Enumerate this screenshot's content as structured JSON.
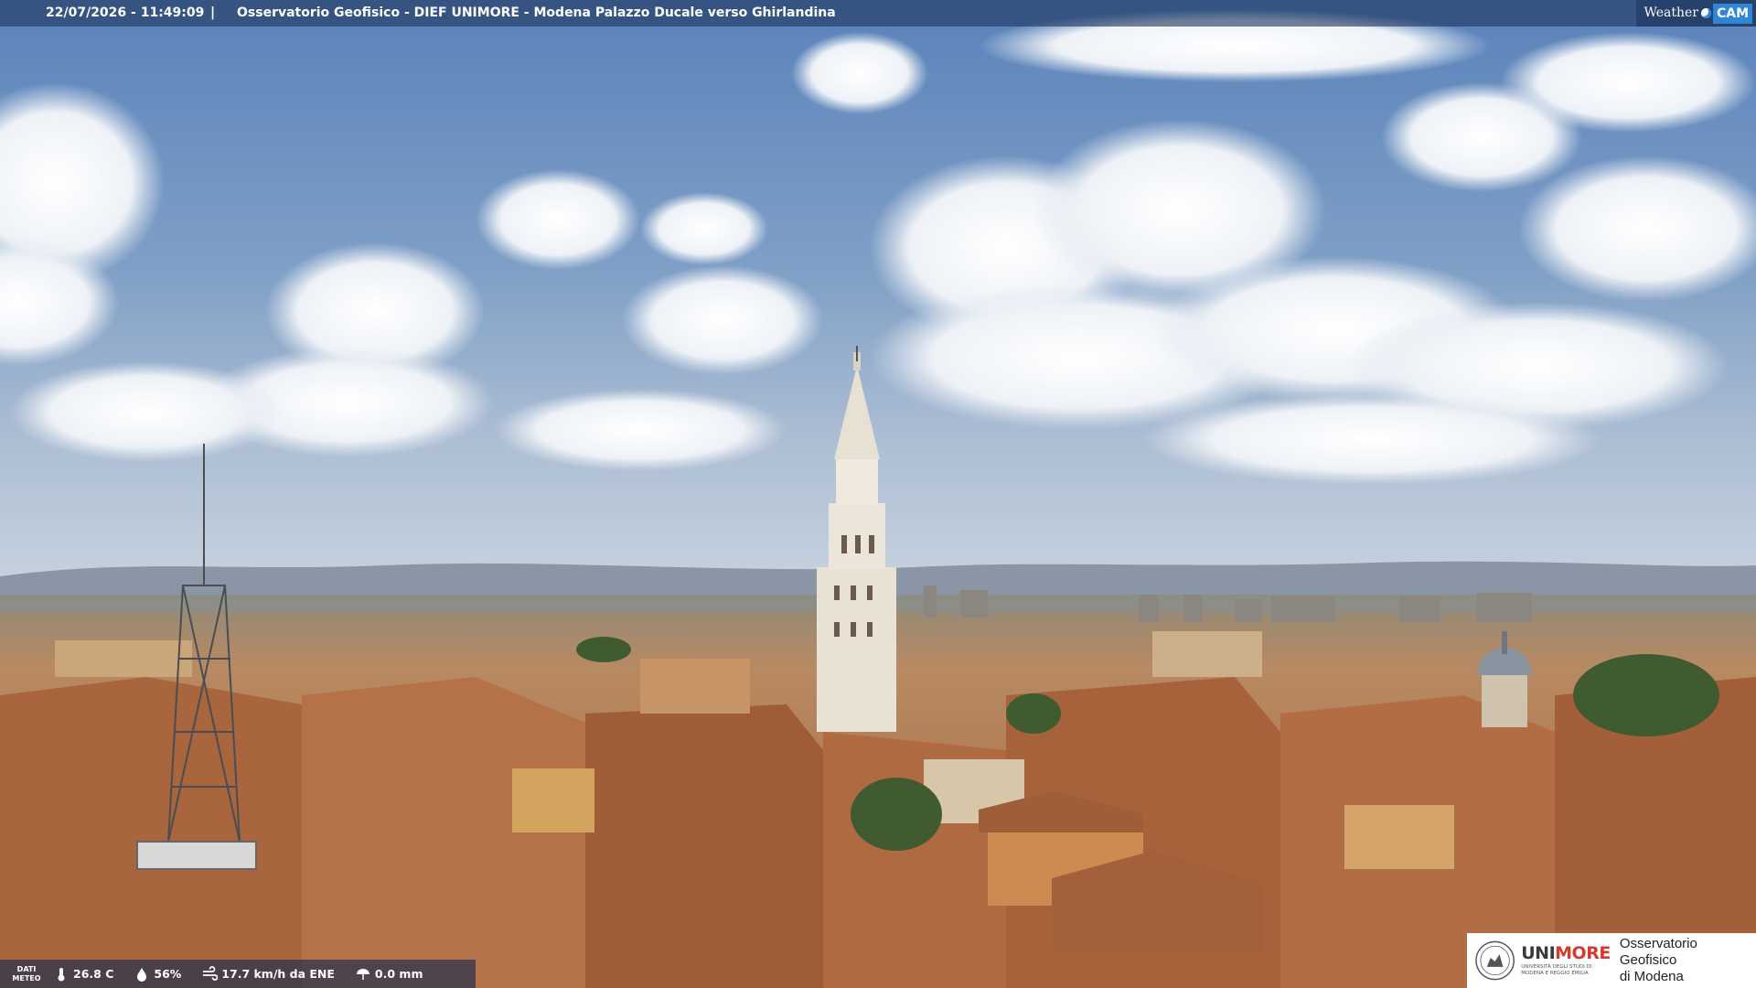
{
  "overlay": {
    "timestamp": "22/07/2026 - 11:49:09",
    "separator": "|",
    "caption": "Osservatorio Geofisico - DIEF UNIMORE - Modena Palazzo Ducale verso Ghirlandina"
  },
  "branding": {
    "weather": "Weather",
    "cam": "CAM"
  },
  "weather_bar": {
    "label_line1": "DATI",
    "label_line2": "METEO",
    "temperature": "26.8 C",
    "humidity": "56%",
    "wind": "17.7 km/h da ENE",
    "rain": "0.0 mm"
  },
  "logo": {
    "unimore_prefix": "UNI",
    "unimore_suffix": "MORE",
    "university_line1": "UNIVERSITÀ DEGLI STUDI DI",
    "university_line2": "MODENA E REGGIO EMILIA",
    "observatory_line1": "Osservatorio Geofisico",
    "observatory_line2": "di Modena"
  },
  "colors": {
    "sky_top": "#5d86bd",
    "sky_horizon": "#b9c9dc",
    "roofs": "#b06f45",
    "walls": "#d6a36e",
    "tower": "#ece5d8",
    "accent_red": "#d33b2c",
    "cam_blue": "#2f86d6"
  },
  "icons": [
    "thermometer-icon",
    "humidity-drop-icon",
    "wind-icon",
    "rain-icon",
    "unimore-seal-icon",
    "weathercam-dot-icon"
  ]
}
